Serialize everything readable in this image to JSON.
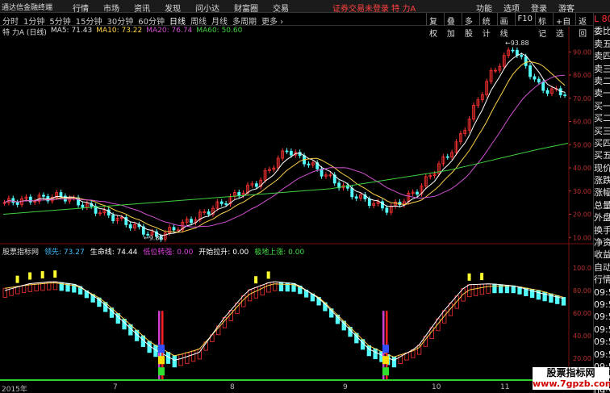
{
  "app": {
    "title": "通达信金融终端"
  },
  "menu": [
    "行情",
    "市场",
    "资讯",
    "发现",
    "问小达",
    "财富圈",
    "交易"
  ],
  "status_text": "证券交易未登录  特 力A",
  "top_right": [
    "功能",
    "选项",
    "登录",
    "游客"
  ],
  "periods": [
    {
      "label": "分时",
      "active": false
    },
    {
      "label": "1分钟",
      "active": false
    },
    {
      "label": "5分钟",
      "active": false
    },
    {
      "label": "15分钟",
      "active": false
    },
    {
      "label": "30分钟",
      "active": false
    },
    {
      "label": "60分钟",
      "active": false
    },
    {
      "label": "日线",
      "active": true
    },
    {
      "label": "周线",
      "active": false
    },
    {
      "label": "月线",
      "active": false
    },
    {
      "label": "多周期",
      "active": false
    },
    {
      "label": "更多 ›",
      "active": false
    }
  ],
  "tools": [
    "复权",
    "叠加",
    "多股",
    "统计",
    "画线",
    "F10",
    "标记",
    "+自选",
    "返回"
  ],
  "stock": {
    "title": "特 力A (日线)"
  },
  "ma": {
    "ma5": "MA5: 71.43",
    "ma10": "MA10: 73.22",
    "ma20": "MA20: 76.74",
    "ma60": "MA60: 50.60"
  },
  "indicator": {
    "name": "股票指标网",
    "lead": "领先: 73.27",
    "life": "生命线: 74.44",
    "low": "低位转强: 0.00",
    "pull": "开始拉升: 0.00",
    "bottom": "极地上涨: 0.00"
  },
  "price_axis": [
    "90.00",
    "80.00",
    "70.00",
    "60.00",
    "50.00",
    "40.00",
    "30.00",
    "20.00",
    "10.00"
  ],
  "ind_axis": [
    "100.0",
    "80.00",
    "60.00",
    "40.00",
    "20.00"
  ],
  "annotations": {
    "high": "93.88",
    "low": "9.88"
  },
  "dates": [
    "2015年",
    "7",
    "8",
    "9",
    "10",
    "11"
  ],
  "sidebar": {
    "top": "L 8000",
    "rows": [
      "委比",
      "卖五",
      "卖四",
      "卖三",
      "卖二",
      "卖一",
      "买一",
      "买二",
      "买三",
      "买四",
      "买五",
      "现价",
      "涨跌",
      "涨幅",
      "总量",
      "外盘",
      "换手",
      "净资",
      "收益",
      "自动",
      "行情",
      "09:5",
      "09:5",
      "09:5",
      "09:5",
      "09:5",
      "09:5",
      "09:5",
      "09:5",
      "09:5",
      "09:5"
    ]
  },
  "watermark": {
    "line1": "股票指标网",
    "line2": "www.7gpzb.com"
  },
  "colors": {
    "up": "#ff3333",
    "down": "#54ffff",
    "ma5": "#ffffff",
    "ma10": "#ffd24a",
    "ma20": "#d050d0",
    "ma60": "#40d040"
  },
  "chart_data": {
    "type": "candlestick",
    "y_range": [
      8,
      96
    ],
    "ma60": [
      20,
      21,
      22,
      23,
      24,
      25,
      26,
      27,
      28,
      29,
      30,
      31,
      33,
      35,
      37,
      39,
      42,
      45,
      48,
      50.6
    ],
    "indicator_range": [
      0,
      110
    ],
    "indicator_lead": [
      80,
      86,
      88,
      85,
      70,
      50,
      30,
      18,
      25,
      55,
      80,
      88,
      86,
      72,
      50,
      28,
      18,
      30,
      60,
      85,
      86,
      84,
      78,
      73
    ],
    "indicator_life": [
      82,
      85,
      87,
      84,
      72,
      53,
      34,
      22,
      28,
      52,
      76,
      86,
      85,
      73,
      52,
      31,
      21,
      28,
      55,
      80,
      84,
      84,
      80,
      74
    ]
  }
}
